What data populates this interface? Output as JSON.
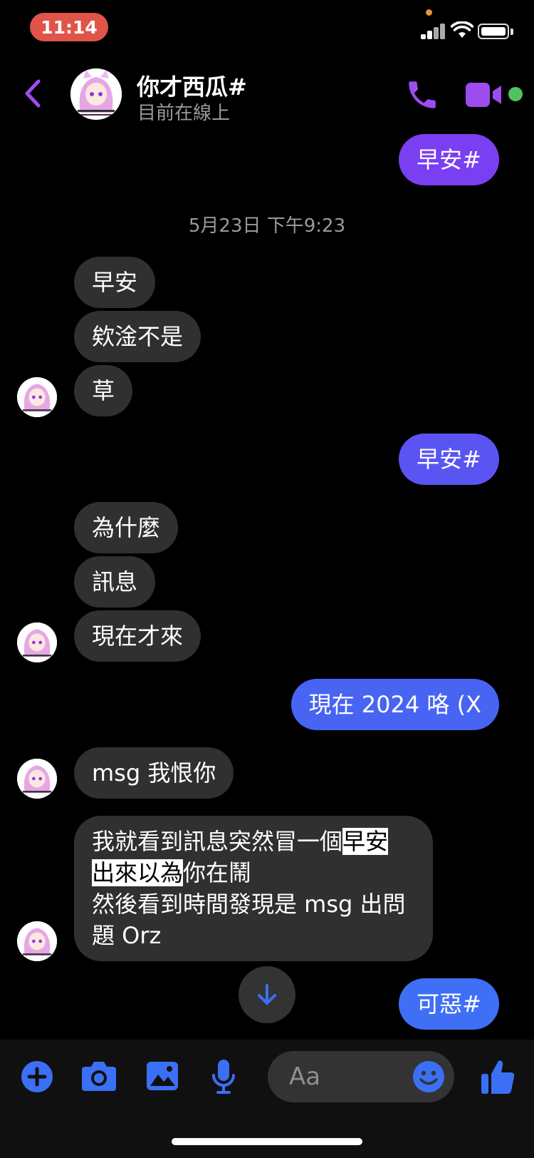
{
  "status_bar": {
    "time": "11:14"
  },
  "header": {
    "name": "你才西瓜#",
    "status": "目前在線上"
  },
  "messages": {
    "m1": "早安#",
    "timestamp": "5月23日 下午9:23",
    "m2": "早安",
    "m3": "欸淦不是",
    "m4": "草",
    "m5": "早安#",
    "m6": "為什麼",
    "m7": "訊息",
    "m8": "現在才來",
    "m9": "現在 2024 咯 (X",
    "m10": "msg 我恨你",
    "m11_a": "我就看到訊息突然冒一個",
    "m11_hl1": "早安",
    "m11_hl2": "出來以為",
    "m11_b": "你在鬧",
    "m11_c": "然後看到時間發現是 msg 出問",
    "m11_d": "題 Orz",
    "m12": "可惡#"
  },
  "composer": {
    "placeholder": "Aa"
  },
  "colors": {
    "outgoing_purple": "#7b3ff2",
    "outgoing_blue": "#3f6ff5",
    "incoming": "#303030",
    "accent_icon": "#9d4cf0",
    "composer_icon": "#3b6ff5",
    "online": "#4fc360"
  }
}
